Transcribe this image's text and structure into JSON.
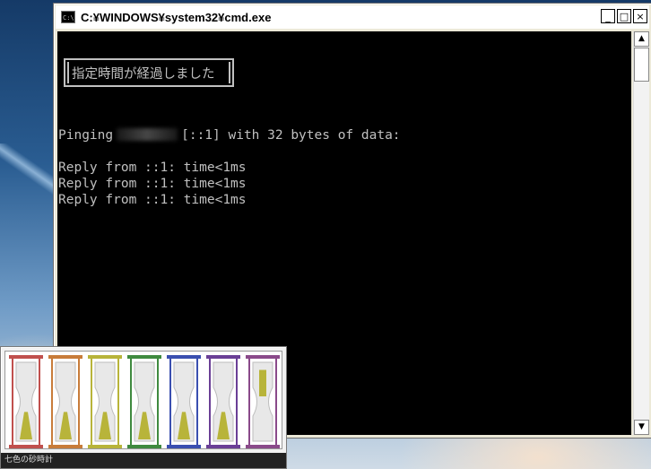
{
  "window": {
    "title": "C:¥WINDOWS¥system32¥cmd.exe",
    "icon_text": "C:\\",
    "minimize": "_",
    "maximize": "□",
    "close": "×"
  },
  "console": {
    "banner": "指定時間が経過しました",
    "ping_prefix": "Pinging",
    "ping_suffix": "[::1] with 32 bytes of data:",
    "replies": [
      "Reply from ::1: time<1ms",
      "Reply from ::1: time<1ms",
      "Reply from ::1: time<1ms"
    ]
  },
  "scrollbar": {
    "up": "▲",
    "down": "▼"
  },
  "gadget": {
    "label": "七色の砂時計",
    "sand_color": "#b8b43a",
    "hourglasses": [
      {
        "color": "#c0504d",
        "top_fill": 0.0,
        "bottom_fill": 0.85
      },
      {
        "color": "#c87c3a",
        "top_fill": 0.0,
        "bottom_fill": 0.85
      },
      {
        "color": "#b8b43a",
        "top_fill": 0.0,
        "bottom_fill": 0.85
      },
      {
        "color": "#3f8a3f",
        "top_fill": 0.0,
        "bottom_fill": 0.85
      },
      {
        "color": "#3a4fb0",
        "top_fill": 0.0,
        "bottom_fill": 0.85
      },
      {
        "color": "#6a3f96",
        "top_fill": 0.0,
        "bottom_fill": 0.85
      },
      {
        "color": "#8a4a8a",
        "top_fill": 0.75,
        "bottom_fill": 0.0
      }
    ]
  }
}
